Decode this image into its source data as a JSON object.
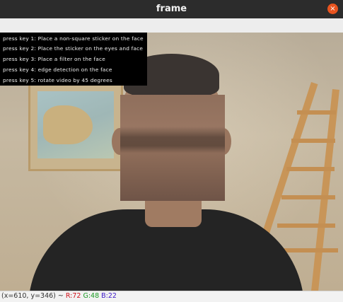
{
  "window": {
    "title": "frame",
    "close_icon": "×"
  },
  "overlay": {
    "lines": [
      "press key 1: Place a non-square sticker on the face",
      "press key 2: Place the sticker on the eyes and face",
      "press key 3: Place a filter on the face",
      "press key 4: edge detection on the face",
      "press key 5: rotate video by 45 degrees"
    ]
  },
  "status": {
    "coords": "(x=610, y=346) ~",
    "r": "R:72",
    "g": "G:48",
    "b": "B:22"
  },
  "colors": {
    "titlebar": "#2c2c2c",
    "close": "#e9541f",
    "r": "#d0121b",
    "g": "#1c9a24",
    "b": "#3b17c8"
  }
}
